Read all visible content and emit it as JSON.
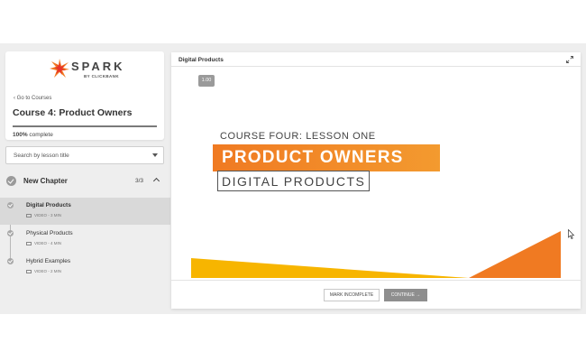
{
  "brand": {
    "name": "SPARK",
    "sub": "BY CLICKBANK",
    "colors": {
      "orange": "#f07a22",
      "red": "#e8342a",
      "yellow": "#f7b500"
    }
  },
  "sidebar": {
    "back_label": "‹ Go to Courses",
    "course_title": "Course 4: Product Owners",
    "progress_percent": 100,
    "progress_value": "100%",
    "progress_suffix": " complete",
    "search_placeholder": "Search by lesson title",
    "chapter": {
      "title": "New Chapter",
      "count": "3/3"
    },
    "lessons": [
      {
        "title": "Digital Products",
        "meta": "VIDEO - 3 MIN",
        "active": true
      },
      {
        "title": "Physical Products",
        "meta": "VIDEO - 4 MIN",
        "active": false
      },
      {
        "title": "Hybrid Examples",
        "meta": "VIDEO - 2 MIN",
        "active": false
      }
    ]
  },
  "main": {
    "title": "Digital Products",
    "playback_speed": "1.00",
    "slide": {
      "line1": "COURSE FOUR: LESSON ONE",
      "line2": "PRODUCT OWNERS",
      "line3": "DIGITAL PRODUCTS"
    },
    "buttons": {
      "mark_incomplete": "MARK INCOMPLETE",
      "continue": "CONTINUE →"
    }
  }
}
